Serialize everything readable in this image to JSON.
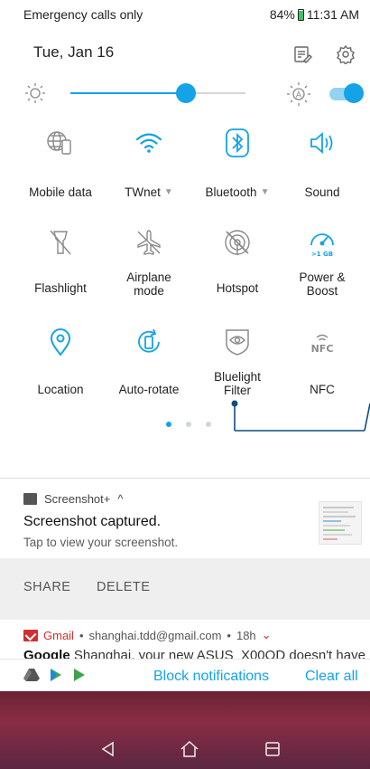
{
  "status_bar": {
    "carrier_text": "Emergency calls only",
    "battery": "84%",
    "time": "11:31 AM"
  },
  "header": {
    "date": "Tue, Jan 16",
    "icons": [
      "edit-tiles-icon",
      "settings-icon"
    ]
  },
  "brightness": {
    "level": 0.66,
    "auto_label": "A",
    "auto_enabled": true
  },
  "tiles": [
    {
      "label": "Mobile data",
      "icon": "mobile-data-icon",
      "active": false,
      "has_dropdown": false
    },
    {
      "label": "TWnet",
      "icon": "wifi-icon",
      "active": true,
      "has_dropdown": true
    },
    {
      "label": "Bluetooth",
      "icon": "bluetooth-icon",
      "active": true,
      "has_dropdown": true
    },
    {
      "label": "Sound",
      "icon": "sound-icon",
      "active": true,
      "has_dropdown": false
    },
    {
      "label": "Flashlight",
      "icon": "flashlight-icon",
      "active": false,
      "has_dropdown": false
    },
    {
      "label": "Airplane mode",
      "icon": "airplane-icon",
      "active": false,
      "has_dropdown": false
    },
    {
      "label": "Hotspot",
      "icon": "hotspot-icon",
      "active": false,
      "has_dropdown": false
    },
    {
      "label": "Power & Boost",
      "icon": "power-boost-icon",
      "active": true,
      "has_dropdown": false,
      "badge": ">1 GB"
    },
    {
      "label": "Location",
      "icon": "location-icon",
      "active": true,
      "has_dropdown": false
    },
    {
      "label": "Auto-rotate",
      "icon": "auto-rotate-icon",
      "active": true,
      "has_dropdown": false
    },
    {
      "label": "Bluelight Filter",
      "icon": "bluelight-filter-icon",
      "active": false,
      "has_dropdown": false
    },
    {
      "label": "NFC",
      "icon": "nfc-icon",
      "active": false,
      "has_dropdown": false,
      "badge": "NFC"
    }
  ],
  "dropdown_arrow": "▼",
  "pagination": {
    "pages": 3,
    "current": 1
  },
  "notification": {
    "app": "Screenshot+",
    "expand": "^",
    "title": "Screenshot captured.",
    "body": "Tap to view your screenshot.",
    "actions": [
      "SHARE",
      "DELETE"
    ]
  },
  "gmail": {
    "app": "Gmail",
    "separator": "•",
    "account": "shanghai.tdd@gmail.com",
    "age": "18h",
    "chevron": "⌄",
    "sender": "Google",
    "preview": "Shanghai, your new ASUS_X00QD doesn't have"
  },
  "footer": {
    "block": "Block notifications",
    "clear": "Clear all"
  },
  "nav": [
    "back-icon",
    "home-icon",
    "recents-icon"
  ],
  "colors": {
    "accent": "#14a3e6",
    "inactive_icon": "#8a8a8a",
    "gmail_red": "#d32f2f",
    "wallpaper": "#6b2333"
  }
}
